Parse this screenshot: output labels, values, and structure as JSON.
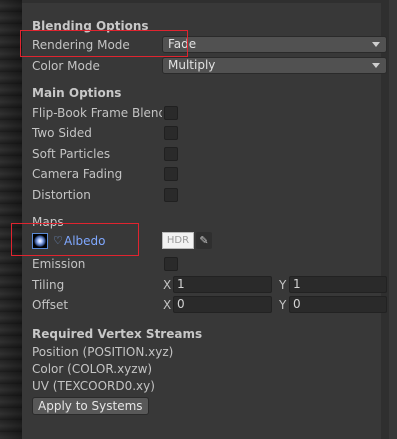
{
  "blending": {
    "header": "Blending Options",
    "rendering_mode_label": "Rendering Mode",
    "rendering_mode_value": "Fade",
    "color_mode_label": "Color Mode",
    "color_mode_value": "Multiply"
  },
  "main_options": {
    "header": "Main Options",
    "items": [
      {
        "label": "Flip-Book Frame Blending",
        "checked": false
      },
      {
        "label": "Two Sided",
        "checked": false
      },
      {
        "label": "Soft Particles",
        "checked": false
      },
      {
        "label": "Camera Fading",
        "checked": false
      },
      {
        "label": "Distortion",
        "checked": false
      }
    ]
  },
  "maps": {
    "header": "Maps",
    "albedo_label": "Albedo",
    "hdr_label": "HDR",
    "emission_label": "Emission",
    "emission_checked": false,
    "tiling_label": "Tiling",
    "tiling_x_label": "X",
    "tiling_x": "1",
    "tiling_y_label": "Y",
    "tiling_y": "1",
    "offset_label": "Offset",
    "offset_x_label": "X",
    "offset_x": "0",
    "offset_y_label": "Y",
    "offset_y": "0"
  },
  "vertex_streams": {
    "header": "Required Vertex Streams",
    "streams": [
      "Position (POSITION.xyz)",
      "Color (COLOR.xyzw)",
      "UV (TEXCOORD0.xy)"
    ],
    "apply_button": "Apply to Systems"
  },
  "icons": {
    "dropdown": "chevron-down-icon",
    "eyedropper": "eyedropper-icon",
    "albedo_texture": "texture-thumbnail-icon",
    "albedo_marker": "heart-icon"
  },
  "colors": {
    "highlight": "#e0242f",
    "albedo_text": "#7fa8ff"
  }
}
